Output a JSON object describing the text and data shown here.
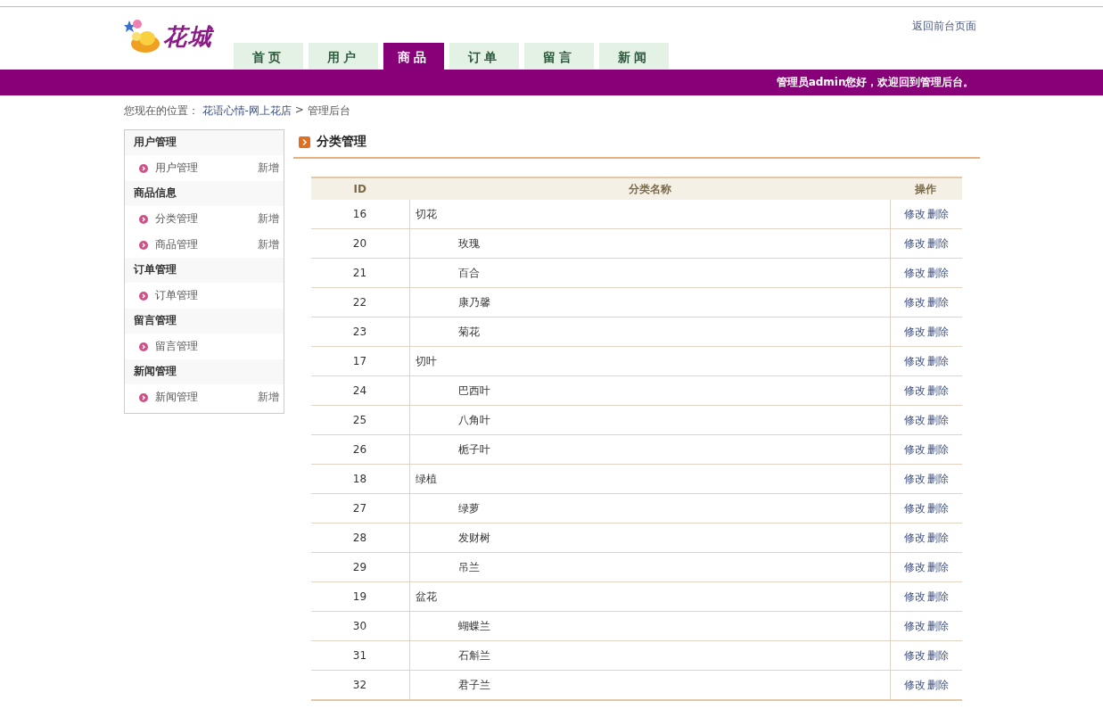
{
  "header": {
    "logo_text": "花城",
    "back_link": "返回前台页面",
    "tabs": [
      {
        "label": "首页",
        "selected": false
      },
      {
        "label": "用户",
        "selected": false
      },
      {
        "label": "商品",
        "selected": true
      },
      {
        "label": "订单",
        "selected": false
      },
      {
        "label": "留言",
        "selected": false
      },
      {
        "label": "新闻",
        "selected": false
      }
    ],
    "welcome": "管理员admin您好，欢迎回到管理后台。"
  },
  "breadcrumb": {
    "label": "您现在的位置：",
    "link": "花语心情-网上花店",
    "separator": ">",
    "current": "管理后台"
  },
  "sidebar": [
    {
      "title": "用户管理",
      "items": [
        {
          "label": "用户管理",
          "action": "新增"
        }
      ]
    },
    {
      "title": "商品信息",
      "items": [
        {
          "label": "分类管理",
          "action": "新增"
        },
        {
          "label": "商品管理",
          "action": "新增"
        }
      ]
    },
    {
      "title": "订单管理",
      "items": [
        {
          "label": "订单管理"
        }
      ]
    },
    {
      "title": "留言管理",
      "items": [
        {
          "label": "留言管理"
        }
      ]
    },
    {
      "title": "新闻管理",
      "items": [
        {
          "label": "新闻管理",
          "action": "新增"
        }
      ]
    }
  ],
  "main": {
    "title": "分类管理",
    "table": {
      "columns": [
        "ID",
        "分类名称",
        "操作"
      ],
      "rows": [
        {
          "id": "16",
          "name": "切花",
          "actions": [
            "修改",
            "删除"
          ],
          "children": [
            {
              "id": "20",
              "name": "玫瑰",
              "actions": [
                "修改",
                "删除"
              ]
            },
            {
              "id": "21",
              "name": "百合",
              "actions": [
                "修改",
                "删除"
              ]
            },
            {
              "id": "22",
              "name": "康乃馨",
              "actions": [
                "修改",
                "删除"
              ]
            },
            {
              "id": "23",
              "name": "菊花",
              "actions": [
                "修改",
                "删除"
              ]
            }
          ]
        },
        {
          "id": "17",
          "name": "切叶",
          "actions": [
            "修改",
            "删除"
          ],
          "children": [
            {
              "id": "24",
              "name": "巴西叶",
              "actions": [
                "修改",
                "删除"
              ]
            },
            {
              "id": "25",
              "name": "八角叶",
              "actions": [
                "修改",
                "删除"
              ]
            },
            {
              "id": "26",
              "name": "栀子叶",
              "actions": [
                "修改",
                "删除"
              ]
            }
          ]
        },
        {
          "id": "18",
          "name": "绿植",
          "actions": [
            "修改",
            "删除"
          ],
          "children": [
            {
              "id": "27",
              "name": "绿萝",
              "actions": [
                "修改",
                "删除"
              ]
            },
            {
              "id": "28",
              "name": "发财树",
              "actions": [
                "修改",
                "删除"
              ]
            },
            {
              "id": "29",
              "name": "吊兰",
              "actions": [
                "修改",
                "删除"
              ]
            }
          ]
        },
        {
          "id": "19",
          "name": "盆花",
          "actions": [
            "修改",
            "删除"
          ],
          "children": [
            {
              "id": "30",
              "name": "蝴蝶兰",
              "actions": [
                "修改",
                "删除"
              ]
            },
            {
              "id": "31",
              "name": "石斛兰",
              "actions": [
                "修改",
                "删除"
              ]
            },
            {
              "id": "32",
              "name": "君子兰",
              "actions": [
                "修改",
                "删除"
              ]
            }
          ]
        }
      ]
    }
  }
}
